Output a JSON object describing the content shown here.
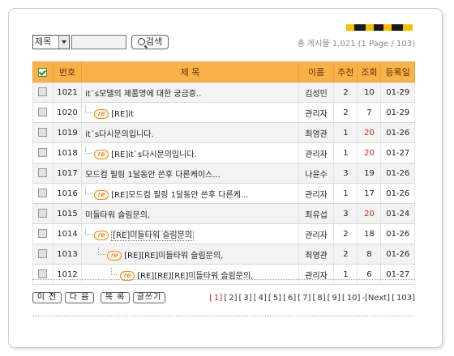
{
  "colors": {
    "header_bg": "#f7b24a",
    "accent_red": "#e0201a",
    "re_badge": "#e38b1c"
  },
  "search": {
    "field_select_value": "제목",
    "query_value": "",
    "button_label": "검색"
  },
  "total_text": "총 게시물 1,021 (1 Page / 103)",
  "table": {
    "headers": [
      "번호",
      "제 목",
      "이름",
      "추천",
      "조회",
      "등록일"
    ],
    "rows": [
      {
        "num": "1021",
        "depth": 0,
        "reply": false,
        "title": "it`s모델의 제품명에 대한 궁금증..",
        "name": "김성민",
        "rec": "2",
        "views": "10",
        "date": "01-29"
      },
      {
        "num": "1020",
        "depth": 1,
        "reply": true,
        "title": "[RE]it",
        "name": "관리자",
        "rec": "2",
        "views": "7",
        "date": "01-29"
      },
      {
        "num": "1019",
        "depth": 0,
        "reply": false,
        "title": "it`s다시문의입니다.",
        "name": "최영관",
        "rec": "1",
        "views": "20",
        "date": "01-26"
      },
      {
        "num": "1018",
        "depth": 1,
        "reply": true,
        "title": "[RE]it`s다시문의입니다.",
        "name": "관리자",
        "rec": "1",
        "views": "20",
        "date": "01-27"
      },
      {
        "num": "1017",
        "depth": 0,
        "reply": false,
        "title": "모드컴 필링 1달동안 쓴후 다른케이스...",
        "name": "나윤수",
        "rec": "3",
        "views": "19",
        "date": "01-26"
      },
      {
        "num": "1016",
        "depth": 1,
        "reply": true,
        "title": "[RE]모드컴 필링 1달동안 쓴후 다른케...",
        "name": "관리자",
        "rec": "1",
        "views": "17",
        "date": "01-26"
      },
      {
        "num": "1015",
        "depth": 0,
        "reply": false,
        "title": "미들타워 슬림문의,",
        "name": "최유섭",
        "rec": "3",
        "views": "20",
        "date": "01-24"
      },
      {
        "num": "1014",
        "depth": 1,
        "reply": true,
        "title": "[RE]미들타워 슬림문의",
        "name": "관리자",
        "rec": "2",
        "views": "18",
        "date": "01-26"
      },
      {
        "num": "1013",
        "depth": 2,
        "reply": true,
        "title": "[RE][RE]미들타워 슬림문의,",
        "name": "최영관",
        "rec": "2",
        "views": "8",
        "date": "01-26"
      },
      {
        "num": "1012",
        "depth": 3,
        "reply": true,
        "title": "[RE][RE][RE]미들타워 슬림문의,",
        "name": "관리자",
        "rec": "1",
        "views": "6",
        "date": "01-27"
      }
    ]
  },
  "nav": {
    "prev": "이 전",
    "next": "다 음",
    "list": "목 록",
    "write": "글쓰기"
  },
  "pagination": {
    "current": "1",
    "pages": [
      "2",
      "3",
      "4",
      "5",
      "6",
      "7",
      "8",
      "9",
      "10"
    ],
    "next_label": "-[Next]",
    "last": "103"
  }
}
